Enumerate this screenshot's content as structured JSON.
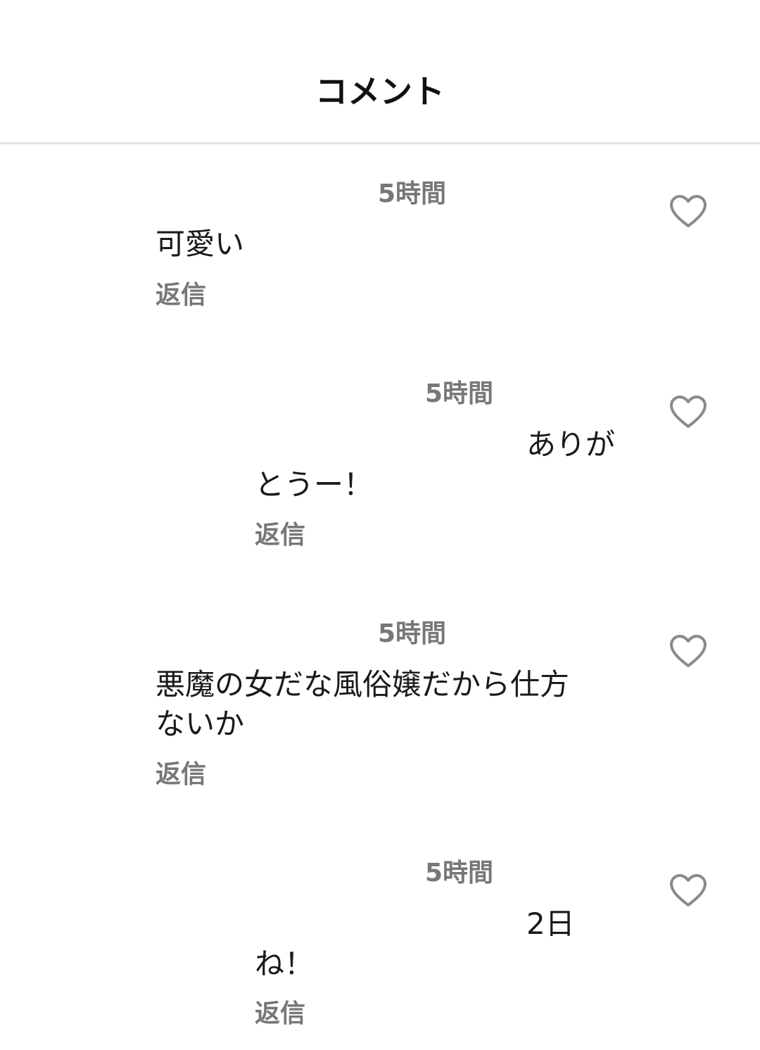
{
  "header": {
    "title": "コメント"
  },
  "comments": [
    {
      "time": "5時間",
      "lines": [
        "可愛い"
      ],
      "reply_label": "返信",
      "like_icon": "heart-outline-icon"
    },
    {
      "time": "5時間",
      "lines": [
        "ありが",
        "とうー！"
      ],
      "reply_label": "返信",
      "like_icon": "heart-outline-icon"
    },
    {
      "time": "5時間",
      "lines": [
        "悪魔の女だな風俗嬢だから仕方",
        "ないか"
      ],
      "reply_label": "返信",
      "like_icon": "heart-outline-icon"
    },
    {
      "time": "5時間",
      "lines": [
        "2日",
        "ね！"
      ],
      "reply_label": "返信",
      "like_icon": "heart-outline-icon"
    }
  ],
  "colors": {
    "divider": "#e2e2e2",
    "meta_text": "#777777",
    "body_text": "#1a1a1a",
    "icon_stroke": "#8a8a8a"
  }
}
